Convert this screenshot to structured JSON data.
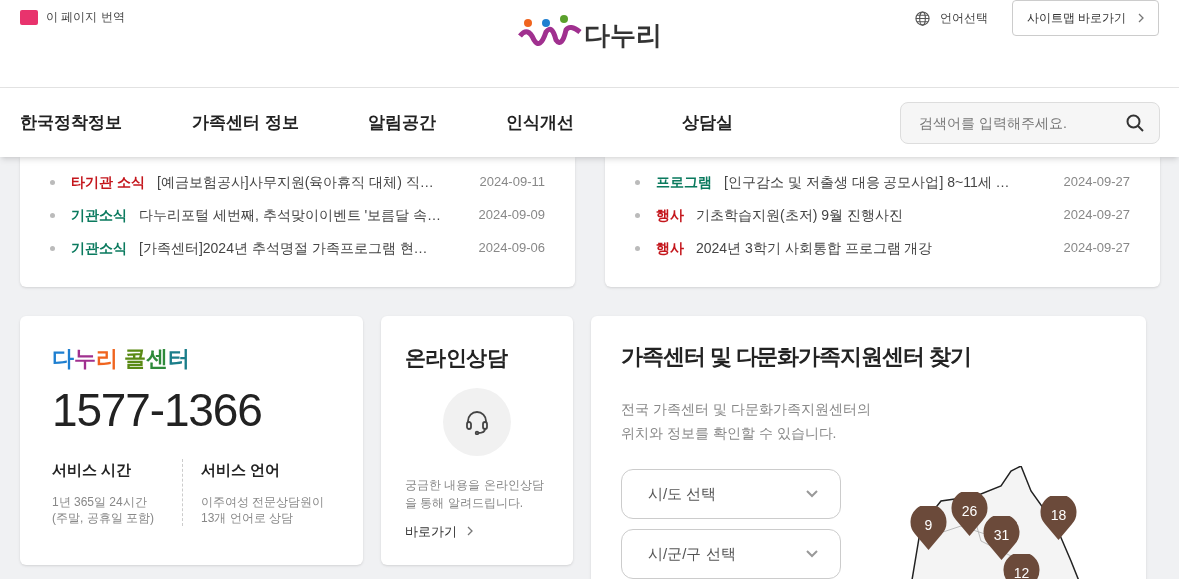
{
  "header": {
    "translate": "이 페이지 번역",
    "logo_text": "다누리",
    "language": "언어선택",
    "sitemap": "사이트맵 바로가기"
  },
  "nav": {
    "items": [
      "한국정착정보",
      "가족센터 정보",
      "알림공간",
      "인식개선",
      "상담실"
    ],
    "search": {
      "placeholder": "검색어를 입력해주세요."
    }
  },
  "news_left": [
    {
      "category": "타기관 소식",
      "color": "#c4161c",
      "title": "[예금보험공사]사무지원(육아휴직 대체) 직…",
      "date": "2024-09-11"
    },
    {
      "category": "기관소식",
      "color": "#0a7a5e",
      "title": "다누리포털 세번째, 추석맞이이벤트 '보름달 속…",
      "date": "2024-09-09"
    },
    {
      "category": "기관소식",
      "color": "#0a7a5e",
      "title": "[가족센터]2024년 추석명절 가족프로그램 현…",
      "date": "2024-09-06"
    }
  ],
  "news_right": [
    {
      "category": "프로그램",
      "color": "#0a7a5e",
      "title": "[인구감소 및 저출생 대응 공모사업] 8~11세 …",
      "date": "2024-09-27"
    },
    {
      "category": "행사",
      "color": "#c4161c",
      "title": "기초학습지원(초저) 9월 진행사진",
      "date": "2024-09-27"
    },
    {
      "category": "행사",
      "color": "#c4161c",
      "title": "2024년 3학기 사회통합 프로그램 개강",
      "date": "2024-09-27"
    }
  ],
  "call_center": {
    "title_parts": [
      {
        "text": "다",
        "color": "#1e7fd0"
      },
      {
        "text": "누",
        "color": "#a0308f"
      },
      {
        "text": "리",
        "color": "#f0641e"
      },
      {
        "text": " 콜",
        "color": "#5a8a14"
      },
      {
        "text": "센",
        "color": "#2e8a3a"
      },
      {
        "text": "터",
        "color": "#1b7e8a"
      }
    ],
    "phone": "1577-1366",
    "info": [
      {
        "label": "서비스 시간",
        "lines": [
          "1년 365일 24시간",
          "(주말, 공휴일 포함)"
        ]
      },
      {
        "label": "서비스 언어",
        "lines": [
          "이주여성 전문상담원이",
          "13개 언어로 상담"
        ]
      }
    ]
  },
  "online": {
    "title": "온라인상담",
    "description": "궁금한 내용을 온라인상담을 통해 알려드립니다.",
    "link": "바로가기"
  },
  "finder": {
    "title": "가족센터 및 다문화가족지원센터 찾기",
    "description": [
      "전국 가족센터 및 다문화가족지원센터의",
      "위치와 정보를 확인할 수 있습니다."
    ],
    "selects": [
      "시/도 선택",
      "시/군/구 선택"
    ],
    "pins": [
      {
        "count": "9"
      },
      {
        "count": "26"
      },
      {
        "count": "31"
      },
      {
        "count": "18"
      },
      {
        "count": "12"
      }
    ]
  }
}
